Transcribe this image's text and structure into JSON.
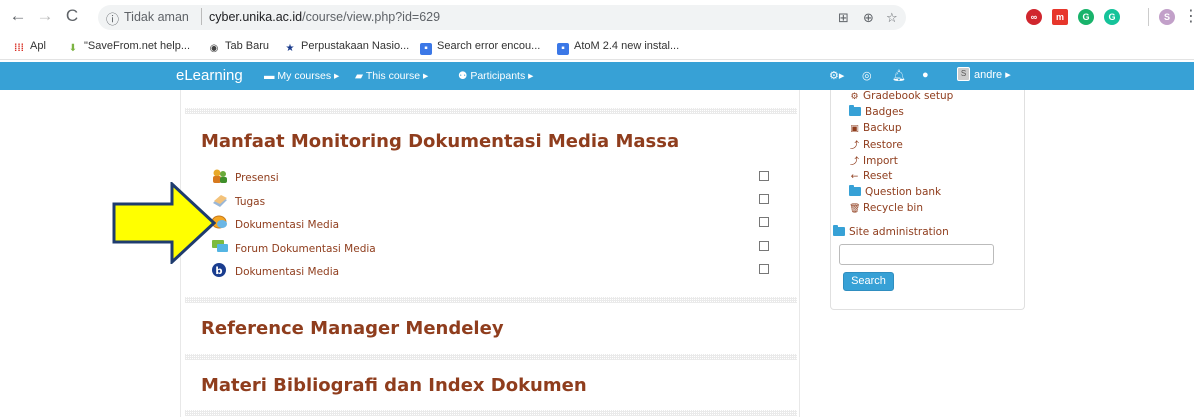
{
  "browser": {
    "insecure_label": "Tidak aman",
    "url_host": "cyber.unika.ac.id",
    "url_path": "/course/view.php?id=629",
    "extension_label": "S"
  },
  "bookmarks": [
    {
      "label": "Apl"
    },
    {
      "label": "\"SaveFrom.net help..."
    },
    {
      "label": "Tab Baru"
    },
    {
      "label": "Perpustakaan Nasio..."
    },
    {
      "label": "Search error encou..."
    },
    {
      "label": "AtoM 2.4 new instal..."
    }
  ],
  "navbar": {
    "brand": "eLearning",
    "my_courses": "My courses ▸",
    "this_course": "This course ▸",
    "participants": "Participants ▸",
    "user_initial": "S",
    "user_name": "andre ▸"
  },
  "sections": [
    {
      "title": "Manfaat Monitoring Dokumentasi Media Massa",
      "activities": [
        {
          "label": "Presensi",
          "icon": "attendance-icon"
        },
        {
          "label": "Tugas",
          "icon": "assignment-icon"
        },
        {
          "label": "Dokumentasi Media",
          "icon": "chat-icon"
        },
        {
          "label": "Forum Dokumentasi Media",
          "icon": "forum-icon"
        },
        {
          "label": "Dokumentasi Media",
          "icon": "bigbluebutton-icon"
        }
      ]
    },
    {
      "title": "Reference Manager Mendeley"
    },
    {
      "title": "Materi Bibliografi dan Index Dokumen"
    }
  ],
  "admin_block": {
    "items": [
      {
        "label": "Gradebook setup",
        "icon": "gear-icon"
      },
      {
        "label": "Badges",
        "icon": "folder-icon"
      },
      {
        "label": "Backup",
        "icon": "backup-icon"
      },
      {
        "label": "Restore",
        "icon": "restore-icon"
      },
      {
        "label": "Import",
        "icon": "import-icon"
      },
      {
        "label": "Reset",
        "icon": "reset-icon"
      },
      {
        "label": "Question bank",
        "icon": "folder-icon"
      },
      {
        "label": "Recycle bin",
        "icon": "trash-icon"
      }
    ],
    "site_admin": "Site administration",
    "search_button": "Search"
  },
  "colors": {
    "navbar": "#37a1d6",
    "link": "#8f3d1d",
    "arrow_fill": "#ffff00",
    "arrow_stroke": "#1f3c6e"
  }
}
